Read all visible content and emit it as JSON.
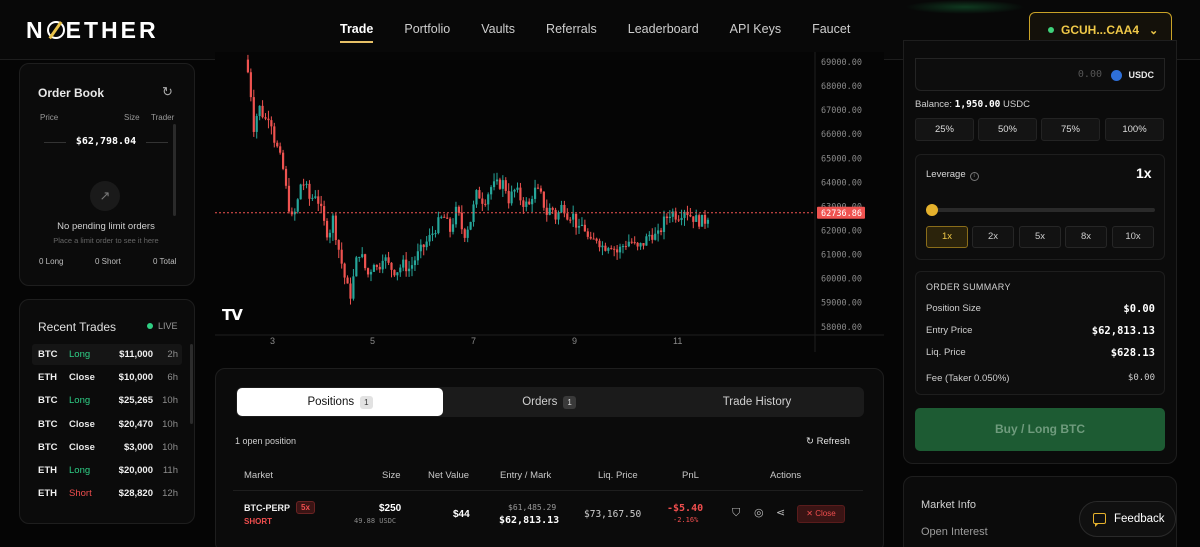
{
  "header": {
    "logo": "NOETHER",
    "nav": [
      "Trade",
      "Portfolio",
      "Vaults",
      "Referrals",
      "Leaderboard",
      "API Keys",
      "Faucet"
    ],
    "active_nav": "Trade",
    "wallet": "GCUH...CAA4"
  },
  "order_book": {
    "title": "Order Book",
    "col_price": "Price",
    "col_size": "Size",
    "col_trader": "Trader",
    "mid_price": "$62,798.04",
    "empty_text": "No pending limit orders",
    "empty_hint": "Place a limit order to see it here",
    "long_count": "0 Long",
    "short_count": "0 Short",
    "total_count": "0 Total"
  },
  "recent_trades": {
    "title": "Recent Trades",
    "live": "LIVE",
    "rows": [
      {
        "asset": "BTC",
        "side": "Long",
        "amount": "$11,000",
        "age": "2h"
      },
      {
        "asset": "ETH",
        "side": "Close",
        "amount": "$10,000",
        "age": "6h"
      },
      {
        "asset": "BTC",
        "side": "Long",
        "amount": "$25,265",
        "age": "10h"
      },
      {
        "asset": "BTC",
        "side": "Close",
        "amount": "$20,470",
        "age": "10h"
      },
      {
        "asset": "BTC",
        "side": "Close",
        "amount": "$3,000",
        "age": "10h"
      },
      {
        "asset": "ETH",
        "side": "Long",
        "amount": "$20,000",
        "age": "11h"
      },
      {
        "asset": "ETH",
        "side": "Short",
        "amount": "$28,820",
        "age": "12h"
      }
    ]
  },
  "chart": {
    "price_labels": [
      "69000.00",
      "68000.00",
      "67000.00",
      "66000.00",
      "65000.00",
      "64000.00",
      "63000.00",
      "62000.00",
      "61000.00",
      "60000.00",
      "59000.00",
      "58000.00"
    ],
    "current_price": "62736.86",
    "date_labels": [
      "3",
      "5",
      "7",
      "9",
      "11"
    ],
    "watermark": "TV"
  },
  "positions": {
    "tabs": [
      {
        "label": "Positions",
        "count": "1"
      },
      {
        "label": "Orders",
        "count": "1"
      },
      {
        "label": "Trade History",
        "count": ""
      }
    ],
    "open_count": "1 open position",
    "refresh": "Refresh",
    "headers": {
      "market": "Market",
      "size": "Size",
      "net_value": "Net Value",
      "entry_mark": "Entry / Mark",
      "liq": "Liq. Price",
      "pnl": "PnL",
      "actions": "Actions"
    },
    "row": {
      "market": "BTC-PERP",
      "leverage": "5x",
      "side": "SHORT",
      "size": "$250",
      "size_sub": "49.88 USDC",
      "net_value": "$44",
      "entry": "$61,485.29",
      "mark": "$62,813.13",
      "liq": "$73,167.50",
      "pnl": "-$5.40",
      "pnl_pct": "-2.16%",
      "close": "Close"
    }
  },
  "trade_panel": {
    "amount_value": "0.00",
    "amount_unit": "USDC",
    "balance_label": "Balance:",
    "balance_value": "1,950.00",
    "balance_unit": "USDC",
    "pct_buttons": [
      "25%",
      "50%",
      "75%",
      "100%"
    ],
    "leverage_label": "Leverage",
    "leverage_value": "1x",
    "leverage_level": 0,
    "leverage_options": [
      "1x",
      "2x",
      "5x",
      "8x",
      "10x"
    ],
    "summary_title": "ORDER SUMMARY",
    "summary": [
      {
        "label": "Position Size",
        "value": "$0.00"
      },
      {
        "label": "Entry Price",
        "value": "$62,813.13"
      },
      {
        "label": "Liq. Price",
        "value": "$628.13"
      },
      {
        "label": "Fee (Taker 0.050%)",
        "value": "$0.00"
      }
    ],
    "buy_label": "Buy / Long BTC",
    "market_info": "Market Info",
    "open_interest": "Open Interest"
  },
  "feedback": "Feedback",
  "colors": {
    "accent": "#e6c066",
    "up": "#26a69a",
    "down": "#ef5350",
    "buy": "#1d5b33"
  }
}
